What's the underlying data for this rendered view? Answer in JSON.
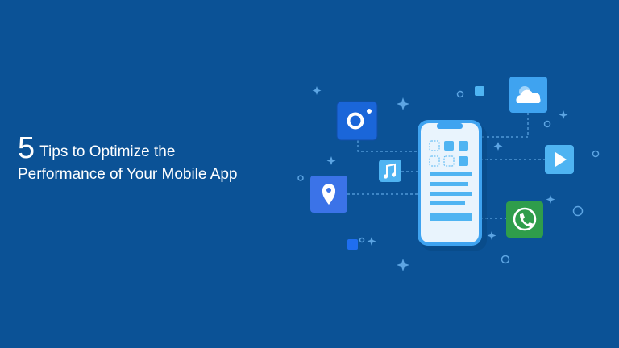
{
  "headline": {
    "number": "5",
    "line1": "Tips to Optimize the",
    "line2": "Performance of Your Mobile App"
  },
  "colors": {
    "background": "#0b5296",
    "phone_body": "#e9f4fd",
    "phone_frame": "#3fa3f0",
    "accent_light": "#4fb4f2",
    "camera_tile": "#1a66d9",
    "location_tile": "#3b73e8",
    "call_tile": "#2f9d4b"
  },
  "icons": [
    "camera-app-icon",
    "cloud-app-icon",
    "music-note-icon",
    "location-pin-icon",
    "play-video-icon",
    "phone-call-icon"
  ]
}
